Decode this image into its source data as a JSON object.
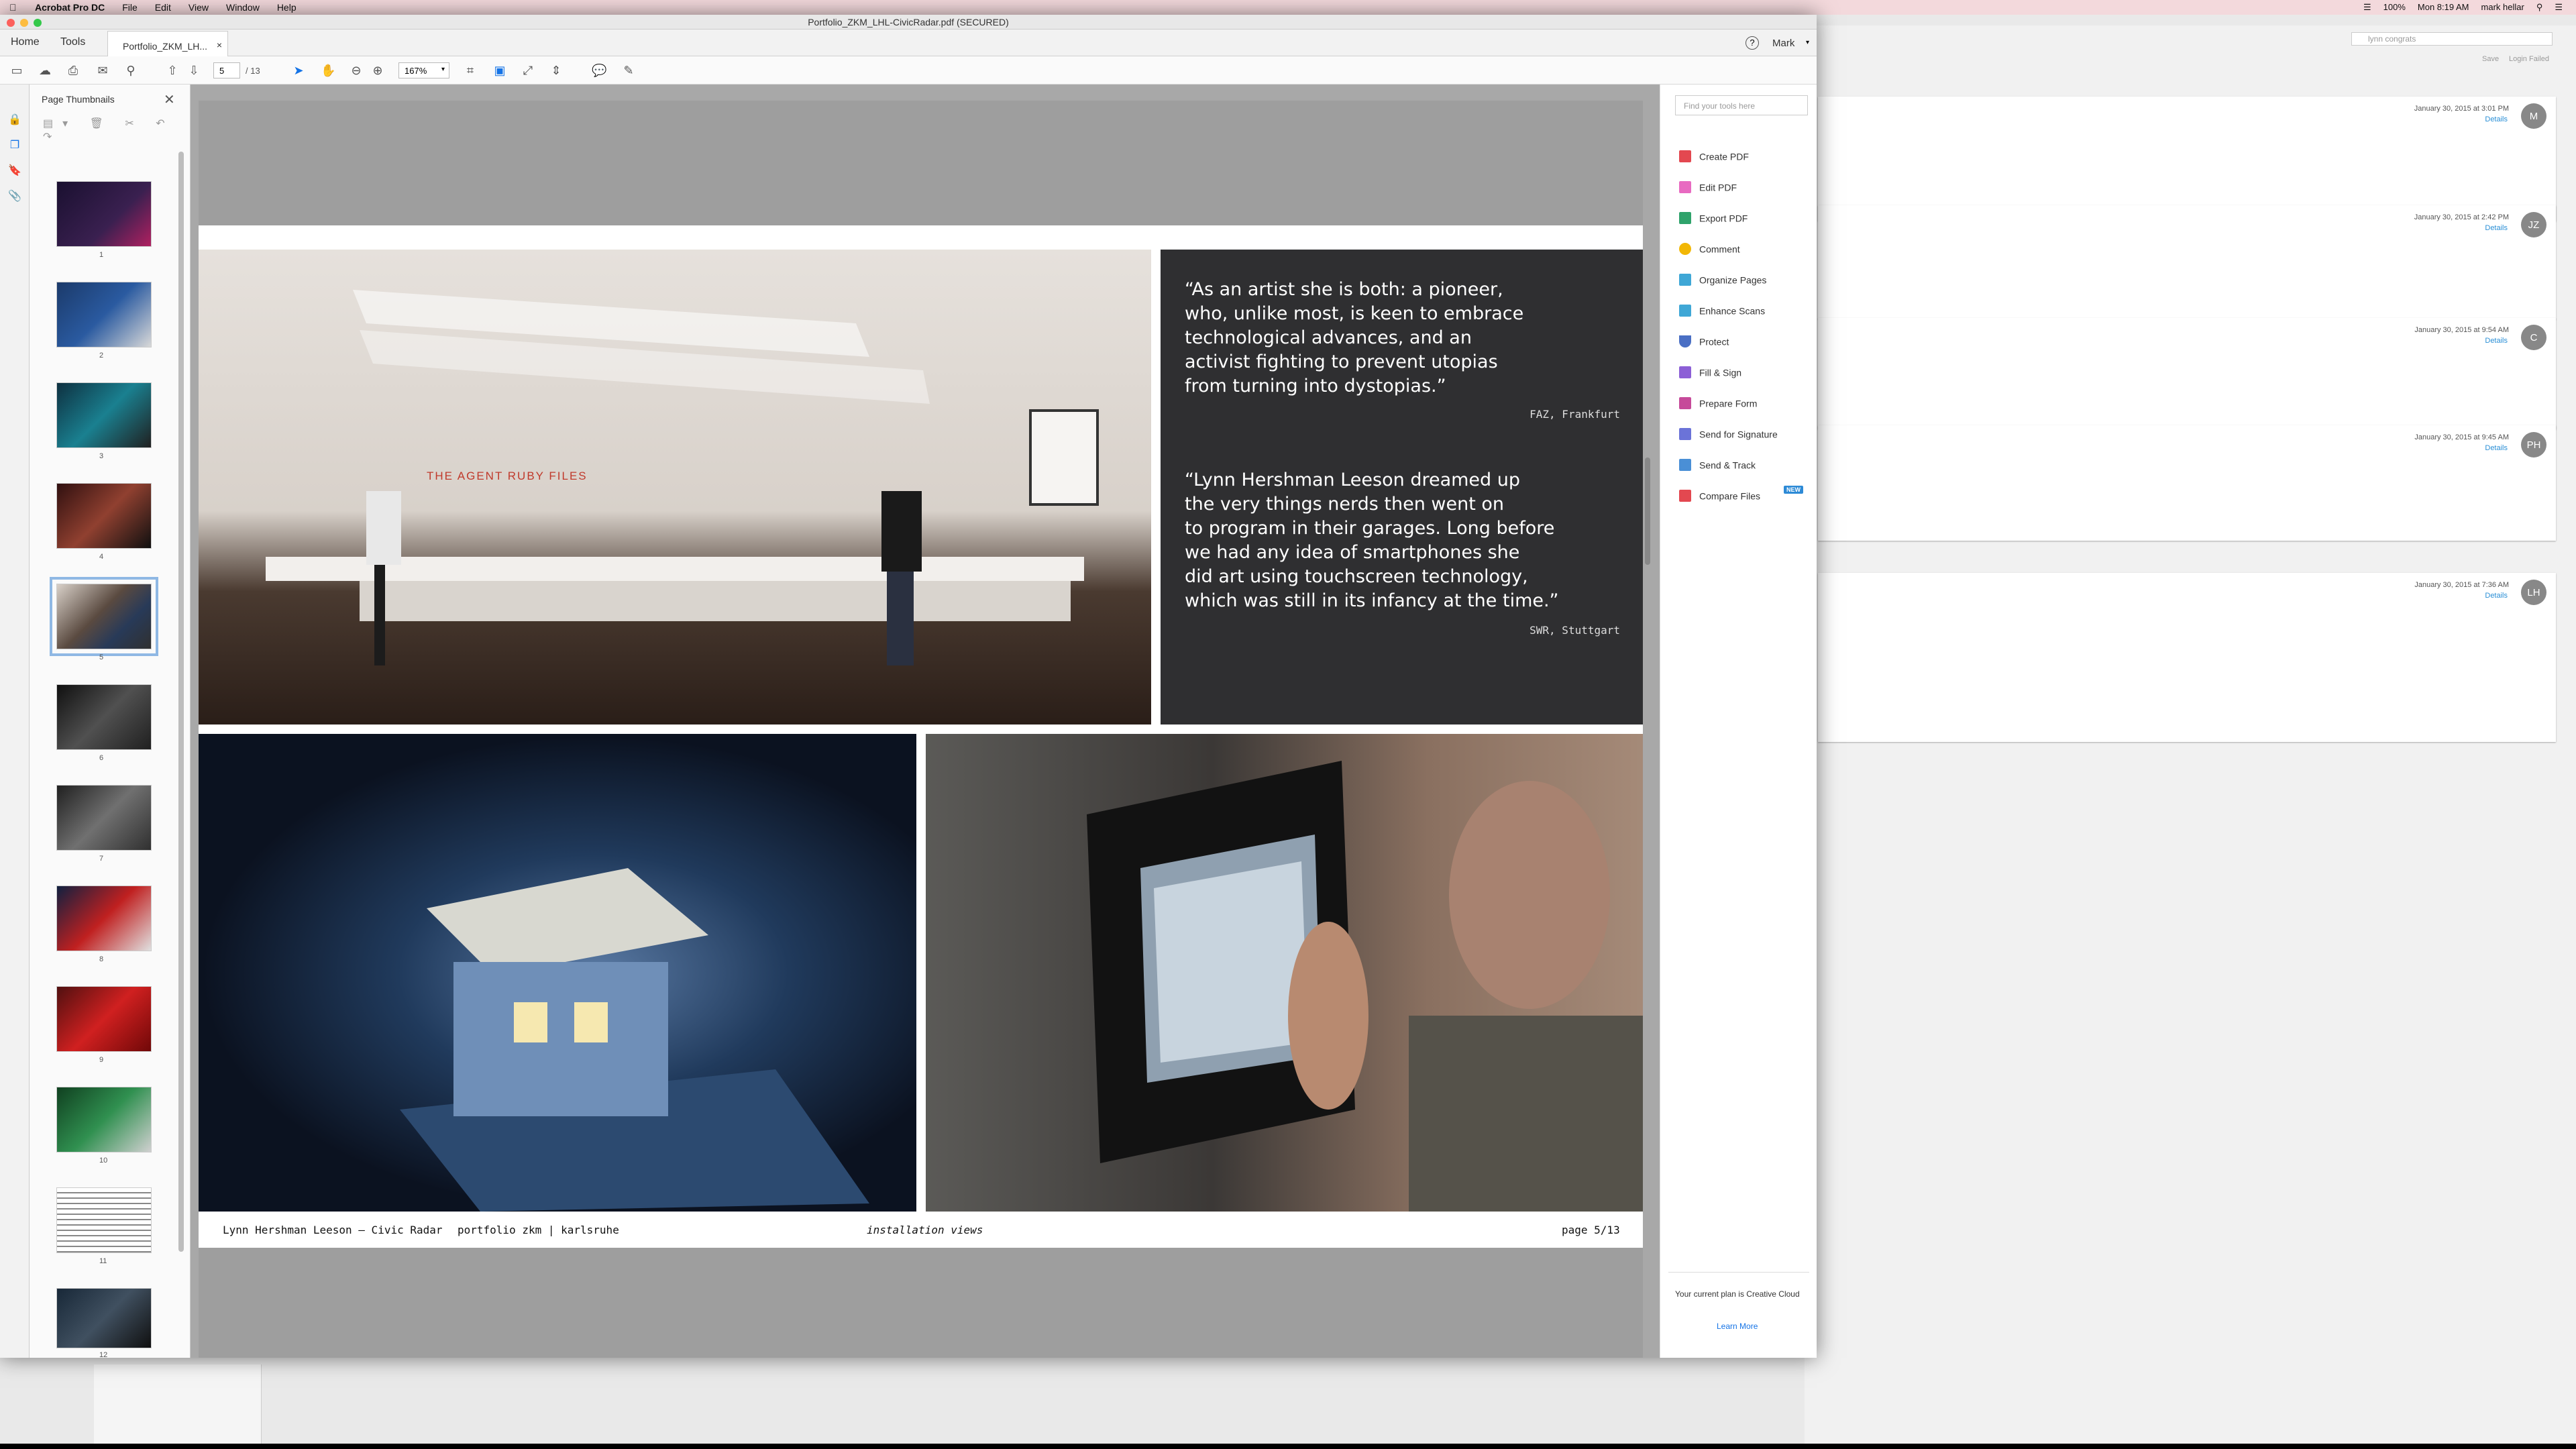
{
  "menubar": {
    "app": "Acrobat Pro DC",
    "items": [
      "File",
      "Edit",
      "View",
      "Window",
      "Help"
    ],
    "battery": "100%",
    "clock": "Mon 8:19 AM",
    "user": "mark hellar"
  },
  "window": {
    "title": "Portfolio_ZKM_LHL-CivicRadar.pdf (SECURED)"
  },
  "nav": {
    "home": "Home",
    "tools": "Tools",
    "doc_tab": "Portfolio_ZKM_LH...",
    "user": "Mark"
  },
  "toolbar": {
    "page_current": "5",
    "page_total": "/ 13",
    "zoom": "167%"
  },
  "thumbnails": {
    "title": "Page Thumbnails",
    "numbers": [
      "1",
      "2",
      "3",
      "4",
      "5",
      "6",
      "7",
      "8",
      "9",
      "10",
      "11",
      "12"
    ]
  },
  "document": {
    "quote1": "“As an artist she is both: a pioneer,\nwho, unlike most, is keen to embrace\ntechnological advances, and an\nactivist fighting to prevent utopias\nfrom turning into dystopias.”",
    "source1": "FAZ, Frankfurt",
    "quote2": "“Lynn Hershman Leeson dreamed up\nthe very things nerds then went on\nto program in their garages. Long before\nwe had any idea of smartphones she\ndid art using touchscreen technology,\nwhich was still in its infancy at the time.”",
    "source2": "SWR, Stuttgart",
    "photo_caption": "THE AGENT RUBY FILES",
    "footer_left": "Lynn Hershman Leeson – Civic Radar",
    "footer_mid": "portfolio zkm | karlsruhe",
    "footer_center": "installation views",
    "footer_right": "page 5/13"
  },
  "tools_pane": {
    "search_placeholder": "Find your tools here",
    "items": [
      {
        "label": "Create PDF",
        "color": "#e34850"
      },
      {
        "label": "Edit PDF",
        "color": "#e86ac1"
      },
      {
        "label": "Export PDF",
        "color": "#2fa36b"
      },
      {
        "label": "Comment",
        "color": "#f2b705"
      },
      {
        "label": "Organize Pages",
        "color": "#3fa7d6"
      },
      {
        "label": "Enhance Scans",
        "color": "#3fa7d6"
      },
      {
        "label": "Protect",
        "color": "#4a6fc4"
      },
      {
        "label": "Fill & Sign",
        "color": "#8c5fd6"
      },
      {
        "label": "Prepare Form",
        "color": "#c64a9a"
      },
      {
        "label": "Send for Signature",
        "color": "#6b73d8"
      },
      {
        "label": "Send & Track",
        "color": "#4a8fd6"
      },
      {
        "label": "Compare Files",
        "color": "#e34850"
      }
    ],
    "new_badge": "NEW",
    "plan_text": "Your current plan is Creative Cloud",
    "learn_more": "Learn More"
  },
  "background_app": {
    "search_text": "lynn congrats",
    "save": "Save",
    "login": "Login Failed",
    "cards": [
      {
        "date": "January 30, 2015 at 3:01 PM",
        "details": "Details",
        "avatar": "M"
      },
      {
        "date": "January 30, 2015 at 2:42 PM",
        "details": "Details",
        "avatar": "JZ"
      },
      {
        "date": "January 30, 2015 at 9:54 AM",
        "details": "Details",
        "avatar": "C"
      },
      {
        "date": "January 30, 2015 at 9:45 AM",
        "details": "Details",
        "avatar": "PH"
      },
      {
        "date": "January 30, 2015 at 7:36 AM",
        "details": "Details",
        "avatar": "LH"
      }
    ]
  }
}
